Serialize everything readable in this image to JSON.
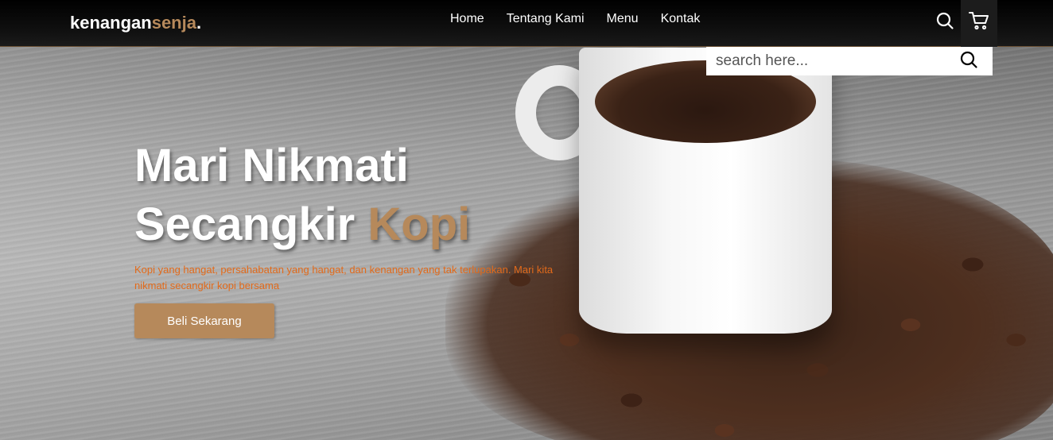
{
  "brand": {
    "name_main": "kenangan",
    "name_accent": "senja",
    "name_dot": "."
  },
  "nav": {
    "links": [
      {
        "label": "Home"
      },
      {
        "label": "Tentang Kami"
      },
      {
        "label": "Menu"
      },
      {
        "label": "Kontak"
      }
    ],
    "icons": [
      "search-icon",
      "cart-icon"
    ]
  },
  "search": {
    "placeholder": "search here...",
    "value": ""
  },
  "hero": {
    "headline_line1": "Mari Nikmati",
    "headline_line2_main": "Secangkir ",
    "headline_line2_accent": "Kopi",
    "tagline": "Kopi yang hangat, persahabatan yang hangat, dan kenangan yang tak terlupakan. Mari kita nikmati secangkir kopi bersama",
    "cta_label": "Beli Sekarang"
  },
  "colors": {
    "accent": "#b6895b",
    "tagline": "#e26a1a",
    "navbar": "#000000",
    "search_bg": "#ffffff"
  }
}
